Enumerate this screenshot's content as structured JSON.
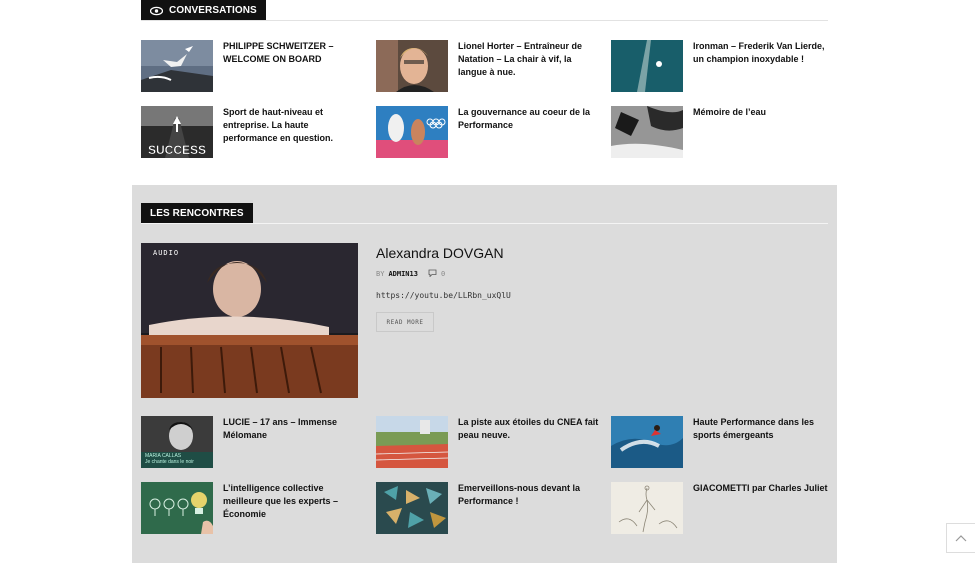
{
  "conversations": {
    "heading": "CONVERSATIONS",
    "items": [
      {
        "title": "PHILIPPE SCHWEITZER – WELCOME ON BOARD"
      },
      {
        "title": "Lionel Horter – Entraîneur de Natation – La chair à vif, la langue à nue."
      },
      {
        "title": "Ironman – Frederik Van Lierde, un champion inoxydable !"
      },
      {
        "title": "Sport de haut-niveau et entreprise. La haute performance en question."
      },
      {
        "title": "La gouvernance au coeur de la Performance"
      },
      {
        "title": "Mémoire de l’eau"
      }
    ],
    "thumb_success_text": "SUCCESS"
  },
  "rencontres": {
    "heading": "LES RENCONTRES",
    "feature": {
      "badge": "AUDIO",
      "title": "Alexandra DOVGAN",
      "by": "BY",
      "author": "ADMIN13",
      "comments": "0",
      "url": "https://youtu.be/LLRbn_uxQlU",
      "read_more": "READ MORE"
    },
    "items": [
      {
        "title": "LUCIE – 17 ans – Immense Mélomane",
        "caption": "MARIA CALLAS\nJe chante dans le noir"
      },
      {
        "title": "La piste aux étoiles du CNEA fait peau neuve."
      },
      {
        "title": "Haute Performance dans les sports émergeants"
      },
      {
        "title": "L’intelligence collective meilleure que les experts – Économie"
      },
      {
        "title": "Emerveillons-nous devant la Performance !"
      },
      {
        "title": "GIACOMETTI par Charles Juliet"
      }
    ]
  },
  "icons": {
    "conversations": "eye-icon",
    "comment": "comment-icon",
    "back_to_top": "chevron-up-icon"
  },
  "colors": {
    "section_bg": "#dcdcdc",
    "tag_bg": "#111111"
  }
}
